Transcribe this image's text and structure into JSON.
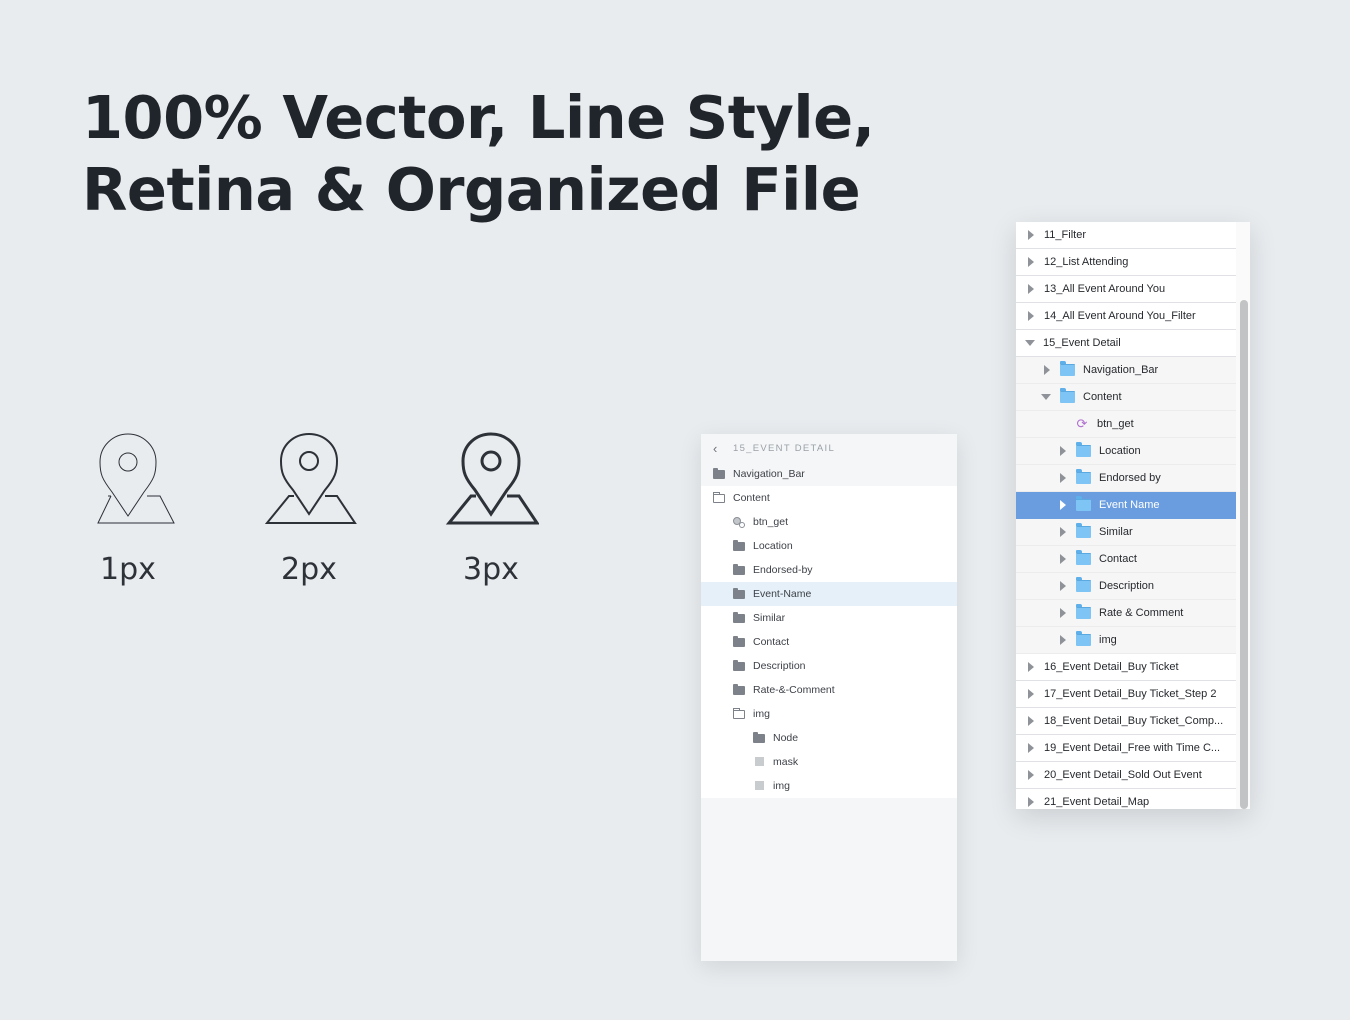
{
  "headline": {
    "line1": "100% Vector, Line Style,",
    "line2": "Retina & Organized File"
  },
  "pins": [
    {
      "label": "1px",
      "icon": "map-pin-icon"
    },
    {
      "label": "2px",
      "icon": "map-pin-icon"
    },
    {
      "label": "3px",
      "icon": "map-pin-icon"
    }
  ],
  "layer_panel": {
    "back_icon": "chevron-left-icon",
    "title": "15_EVENT DETAIL",
    "items": [
      {
        "label": "Navigation_Bar",
        "icon": "folder-icon"
      },
      {
        "label": "Content",
        "icon": "folder-open-icon"
      },
      {
        "label": "btn_get",
        "icon": "symbol-icon"
      },
      {
        "label": "Location",
        "icon": "folder-icon"
      },
      {
        "label": "Endorsed-by",
        "icon": "folder-icon"
      },
      {
        "label": "Event-Name",
        "icon": "folder-icon",
        "selected": true
      },
      {
        "label": "Similar",
        "icon": "folder-icon"
      },
      {
        "label": "Contact",
        "icon": "folder-icon"
      },
      {
        "label": "Description",
        "icon": "folder-icon"
      },
      {
        "label": "Rate-&-Comment",
        "icon": "folder-icon"
      },
      {
        "label": "img",
        "icon": "folder-open-icon"
      },
      {
        "label": "Node",
        "icon": "folder-icon"
      },
      {
        "label": "mask",
        "icon": "square-icon"
      },
      {
        "label": "img",
        "icon": "square-icon"
      }
    ]
  },
  "outline_panel": {
    "rows": [
      {
        "label": "11_Filter"
      },
      {
        "label": "12_List Attending"
      },
      {
        "label": "13_All Event Around You"
      },
      {
        "label": "14_All Event Around You_Filter"
      },
      {
        "label": "15_Event Detail"
      },
      {
        "label": "Navigation_Bar"
      },
      {
        "label": "Content"
      },
      {
        "label": "btn_get"
      },
      {
        "label": "Location"
      },
      {
        "label": "Endorsed by"
      },
      {
        "label": "Event Name",
        "selected": true
      },
      {
        "label": "Similar"
      },
      {
        "label": "Contact"
      },
      {
        "label": "Description"
      },
      {
        "label": "Rate & Comment"
      },
      {
        "label": "img"
      },
      {
        "label": "16_Event Detail_Buy Ticket"
      },
      {
        "label": "17_Event Detail_Buy Ticket_Step 2"
      },
      {
        "label": "18_Event Detail_Buy Ticket_Comp..."
      },
      {
        "label": "19_Event Detail_Free with Time C..."
      },
      {
        "label": "20_Event Detail_Sold Out Event"
      },
      {
        "label": "21_Event Detail_Map"
      }
    ]
  },
  "colors": {
    "background": "#e8ecef",
    "selection_blue": "#6a9de0",
    "selection_light": "#e6f0f8",
    "folder_blue": "#7ec4f4",
    "text_dark": "#20242b"
  }
}
